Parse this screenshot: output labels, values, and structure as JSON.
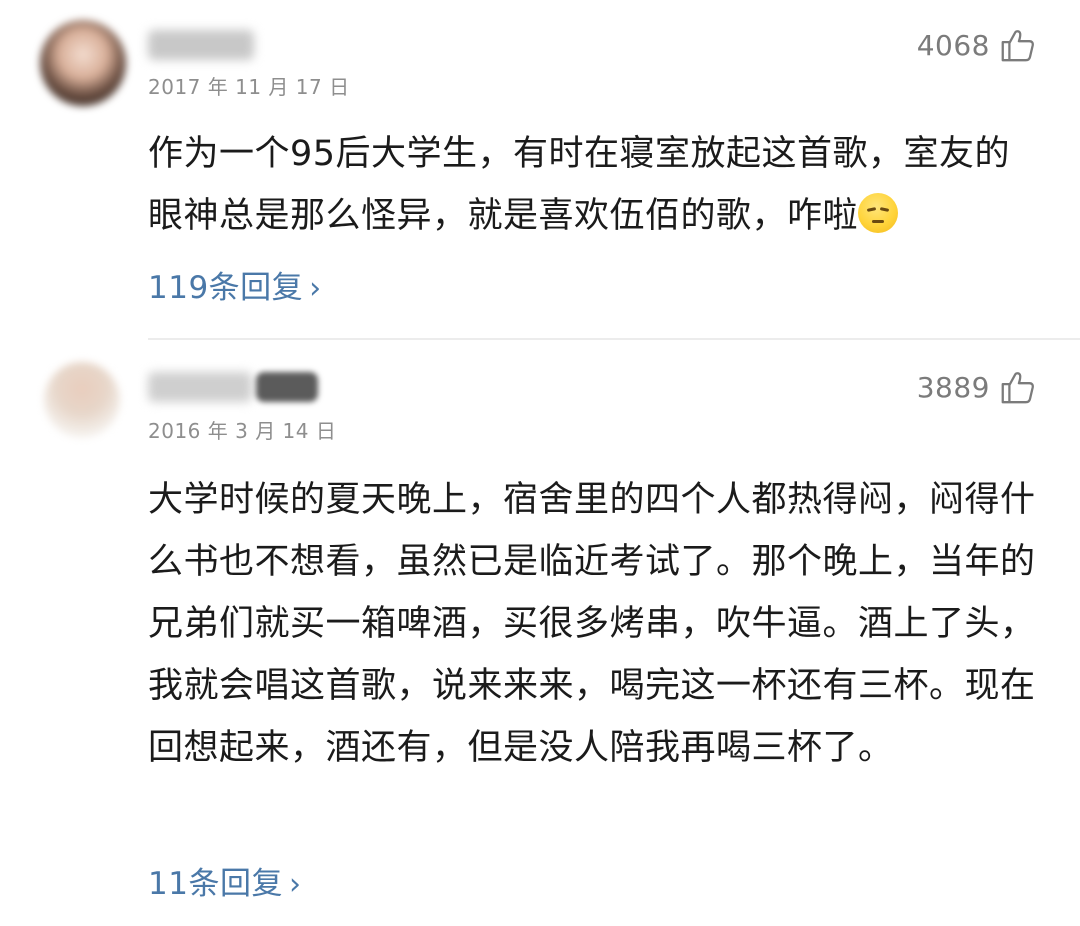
{
  "comments": [
    {
      "date": "2017 年 11 月 17 日",
      "likes": "4068",
      "text": "作为一个95后大学生，有时在寝室放起这首歌，室友的眼神总是那么怪异，就是喜欢伍佰的歌，咋啦",
      "emoji": "pensive-face",
      "replies": "119条回复"
    },
    {
      "date": "2016 年 3 月 14 日",
      "likes": "3889",
      "text": "大学时候的夏天晚上，宿舍里的四个人都热得闷，闷得什么书也不想看，虽然已是临近考试了。那个晚上，当年的兄弟们就买一箱啤酒，买很多烤串，吹牛逼。酒上了头，我就会唱这首歌，说来来来，喝完这一杯还有三杯。现在回想起来，酒还有，但是没人陪我再喝三杯了。",
      "replies": "11条回复"
    }
  ],
  "icons": {
    "like": "thumbs-up-icon",
    "chevron": "chevron-right-icon"
  },
  "colors": {
    "link": "#4a78a8",
    "text": "#1b1b1b",
    "meta": "#8e8e8e"
  }
}
